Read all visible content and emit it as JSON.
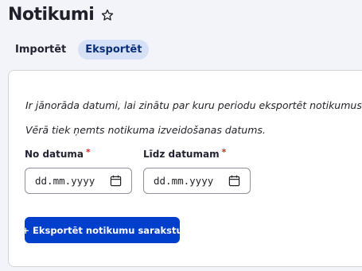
{
  "page": {
    "title": "Notikumi",
    "favorite_icon": "star-outline-icon"
  },
  "tabs": [
    {
      "label": "Importēt",
      "active": false
    },
    {
      "label": "Eksportēt",
      "active": true
    }
  ],
  "form": {
    "description_1": "Ir jānorāda datumi, lai zinātu par kuru periodu eksportēt notikumus.",
    "description_2": "Vērā tiek ņemts notikuma izveidošanas datums.",
    "from_date": {
      "label": "No datuma",
      "required_marker": "*",
      "placeholder": "dd.mm.yyyy",
      "value": "",
      "icon": "calendar-icon"
    },
    "to_date": {
      "label": "Līdz datumam",
      "required_marker": "*",
      "placeholder": "dd.mm.yyyy",
      "value": "",
      "icon": "calendar-icon"
    },
    "export_button": "+ Eksportēt notikumu sarakstu"
  },
  "colors": {
    "accent": "#003ecc",
    "tab_active_bg": "#d6e0f7",
    "required": "#dc2323",
    "background": "#f3f4f9"
  }
}
